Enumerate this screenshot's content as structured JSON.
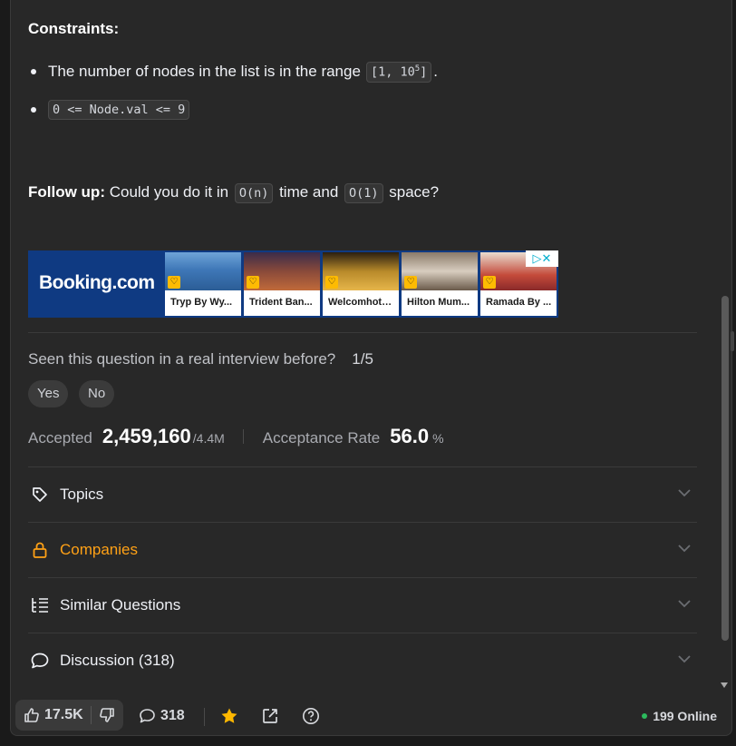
{
  "constraints": {
    "title": "Constraints:",
    "bullet1_text": "The number of nodes in the list is in the range",
    "bullet1_code_pre": "[1, 10",
    "bullet1_code_sup": "5",
    "bullet1_code_post": "]",
    "bullet1_end": ".",
    "bullet2_code": "0 <= Node.val <= 9"
  },
  "followup": {
    "label": "Follow up:",
    "text1": "Could you do it in",
    "code1": "O(n)",
    "text2": "time and",
    "code2": "O(1)",
    "text3": "space?"
  },
  "ad": {
    "logo": "Booking.com",
    "hotels": [
      {
        "name": "Tryp By Wy..."
      },
      {
        "name": "Trident Ban..."
      },
      {
        "name": "Welcomhote..."
      },
      {
        "name": "Hilton Mum..."
      },
      {
        "name": "Ramada By ..."
      }
    ],
    "close_icon": "x-icon",
    "adchoices_icon": "adchoices-icon"
  },
  "interview": {
    "question": "Seen this question in a real interview before?",
    "ratio": "1/5",
    "yes": "Yes",
    "no": "No"
  },
  "stats": {
    "accepted_label": "Accepted",
    "accepted_value": "2,459,160",
    "accepted_total": "/4.4M",
    "rate_label": "Acceptance Rate",
    "rate_value": "56.0",
    "rate_unit": "%"
  },
  "sections": {
    "topics": "Topics",
    "companies": "Companies",
    "similar": "Similar Questions",
    "discussion": "Discussion (318)"
  },
  "toolbar": {
    "likes": "17.5K",
    "comments": "318",
    "online": "199 Online"
  },
  "colors": {
    "companies_accent": "#ffa116",
    "online_dot": "#2cbb5d",
    "star": "#ffb800"
  }
}
